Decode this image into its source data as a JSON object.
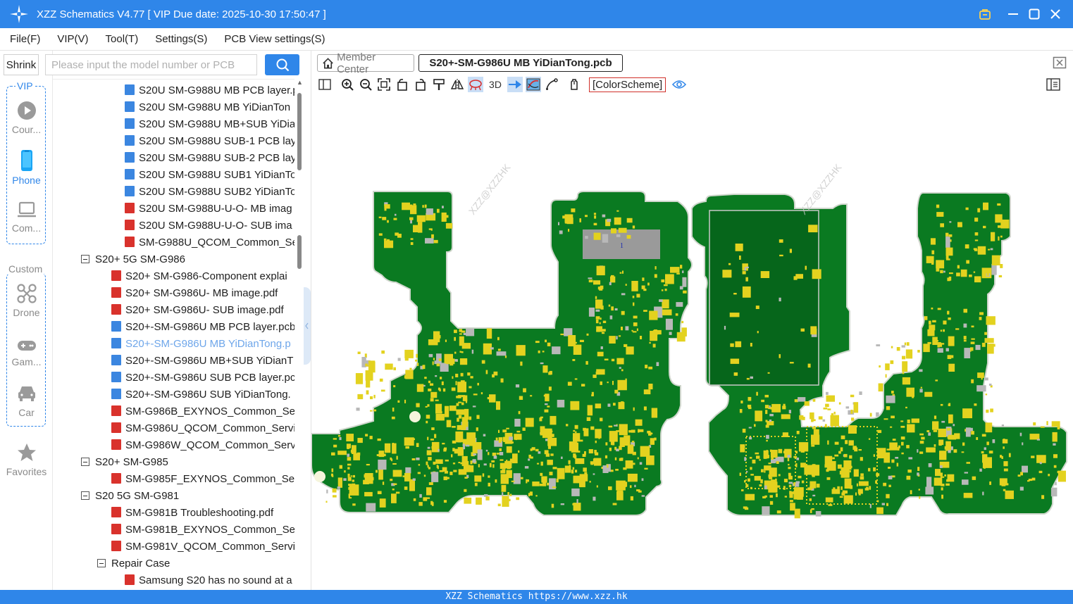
{
  "window": {
    "title": "XZZ Schematics V4.77 [ VIP Due date: 2025-10-30 17:50:47 ]"
  },
  "menu": [
    "File(F)",
    "VIP(V)",
    "Tool(T)",
    "Settings(S)",
    "PCB View settings(S)"
  ],
  "sidebar": {
    "shrink_label": "Shrink",
    "vip_label": "VIP",
    "custom_label": "Custom",
    "items": [
      {
        "label": "Cour...",
        "icon": "play-icon",
        "active": false
      },
      {
        "label": "Phone",
        "icon": "phone-icon",
        "active": true
      },
      {
        "label": "Com...",
        "icon": "laptop-icon",
        "active": false
      },
      {
        "label": "Drone",
        "icon": "drone-icon",
        "active": false
      },
      {
        "label": "Gam...",
        "icon": "gamepad-icon",
        "active": false
      },
      {
        "label": "Car",
        "icon": "car-icon",
        "active": false
      },
      {
        "label": "Favorites",
        "icon": "star-icon",
        "active": false
      }
    ]
  },
  "search": {
    "placeholder": "Please input the model number or PCB"
  },
  "tree": [
    {
      "type": "pcb",
      "label": "S20U SM-G988U MB PCB layer.p",
      "level": 2
    },
    {
      "type": "pcb",
      "label": "S20U SM-G988U MB YiDianTon",
      "level": 2
    },
    {
      "type": "pcb",
      "label": "S20U SM-G988U MB+SUB YiDia",
      "level": 2
    },
    {
      "type": "pcb",
      "label": "S20U SM-G988U SUB-1 PCB laye",
      "level": 2
    },
    {
      "type": "pcb",
      "label": "S20U SM-G988U SUB-2 PCB laye",
      "level": 2
    },
    {
      "type": "pcb",
      "label": "S20U SM-G988U SUB1 YiDianTo",
      "level": 2
    },
    {
      "type": "pcb",
      "label": "S20U SM-G988U SUB2 YiDianTo",
      "level": 2
    },
    {
      "type": "pdf",
      "label": "S20U SM-G988U-U-O- MB imag",
      "level": 2
    },
    {
      "type": "pdf",
      "label": "S20U SM-G988U-U-O- SUB ima",
      "level": 2
    },
    {
      "type": "pdf",
      "label": "SM-G988U_QCOM_Common_Se",
      "level": 2
    },
    {
      "type": "folder",
      "label": "S20+ 5G SM-G986",
      "level": 0
    },
    {
      "type": "pdf",
      "label": "S20+ SM-G986-Component explai",
      "level": 1
    },
    {
      "type": "pdf",
      "label": "S20+ SM-G986U- MB image.pdf",
      "level": 1
    },
    {
      "type": "pdf",
      "label": "S20+ SM-G986U- SUB image.pdf",
      "level": 1
    },
    {
      "type": "pcb",
      "label": "S20+-SM-G986U MB PCB layer.pcb",
      "level": 1
    },
    {
      "type": "pcb",
      "label": "S20+-SM-G986U MB YiDianTong.p",
      "level": 1,
      "selected": true
    },
    {
      "type": "pcb",
      "label": "S20+-SM-G986U MB+SUB YiDianT",
      "level": 1
    },
    {
      "type": "pcb",
      "label": "S20+-SM-G986U SUB PCB layer.pcl",
      "level": 1
    },
    {
      "type": "pcb",
      "label": "S20+-SM-G986U SUB YiDianTong.",
      "level": 1
    },
    {
      "type": "pdf",
      "label": "SM-G986B_EXYNOS_Common_Serv",
      "level": 1
    },
    {
      "type": "pdf",
      "label": "SM-G986U_QCOM_Common_Servi",
      "level": 1
    },
    {
      "type": "pdf",
      "label": "SM-G986W_QCOM_Common_Servi",
      "level": 1
    },
    {
      "type": "folder",
      "label": "S20+ SM-G985",
      "level": 0
    },
    {
      "type": "pdf",
      "label": "SM-G985F_EXYNOS_Common_Serv",
      "level": 1
    },
    {
      "type": "folder",
      "label": "S20 5G SM-G981",
      "level": 0
    },
    {
      "type": "pdf",
      "label": "SM-G981B Troubleshooting.pdf",
      "level": 1
    },
    {
      "type": "pdf",
      "label": "SM-G981B_EXYNOS_Common_Serv",
      "level": 1
    },
    {
      "type": "pdf",
      "label": "SM-G981V_QCOM_Common_Servic",
      "level": 1
    },
    {
      "type": "folder",
      "label": "Repair Case",
      "level": 1
    },
    {
      "type": "pdf",
      "label": "Samsung S20 has no sound at a",
      "level": 2
    }
  ],
  "tabs": {
    "home": "Member Center",
    "active": "S20+-SM-G986U MB YiDianTong.pcb"
  },
  "toolbar": {
    "label_3d": "3D",
    "color_scheme": "[ColorScheme]"
  },
  "board": {
    "watermark": "XZZ@XZZHK",
    "chip_label": "1",
    "colors": {
      "pcb": "#0a7a21",
      "pad": "#e3d21f",
      "gray": "#9a9a9a",
      "outline": "#cfd6cc"
    }
  },
  "status": {
    "text": "XZZ Schematics https://www.xzz.hk"
  },
  "colors": {
    "accent": "#2f86e9"
  }
}
